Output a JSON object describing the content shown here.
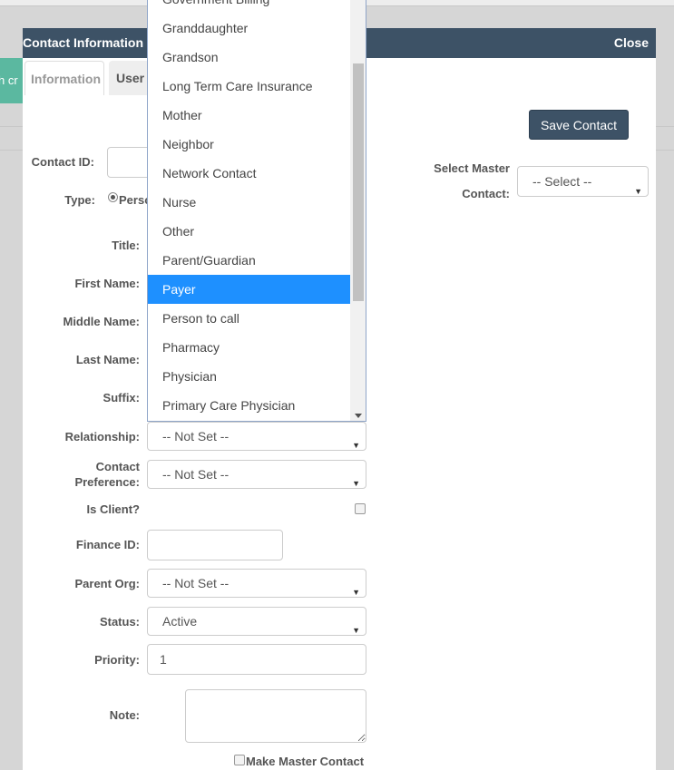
{
  "background": {
    "teal_button_text": "h cr"
  },
  "modal": {
    "title": "Contact Information",
    "close_label": "Close"
  },
  "tabs": [
    {
      "label": "Information"
    },
    {
      "label": "User"
    }
  ],
  "save_button_label": "Save Contact",
  "form": {
    "contact_id_label": "Contact ID:",
    "contact_id_value": "",
    "type_label": "Type:",
    "type_radio_text": "Perso",
    "title_label": "Title:",
    "first_name_label": "First Name:",
    "middle_name_label": "Middle Name:",
    "last_name_label": "Last Name:",
    "suffix_label": "Suffix:",
    "relationship_label": "Relationship:",
    "relationship_value": "-- Not Set --",
    "contact_pref_label_1": "Contact",
    "contact_pref_label_2": "Preference:",
    "contact_pref_value": "-- Not Set --",
    "is_client_label": "Is Client?",
    "finance_id_label": "Finance ID:",
    "finance_id_value": "",
    "parent_org_label": "Parent Org:",
    "parent_org_value": "-- Not Set --",
    "status_label": "Status:",
    "status_value": "Active",
    "priority_label": "Priority:",
    "priority_value": "1",
    "note_label": "Note:",
    "note_value": "",
    "make_master_label": "Make Master Contact",
    "select_master_label_1": "Select Master",
    "select_master_label_2": "Contact:",
    "select_master_value": "-- Select --"
  },
  "dropdown": {
    "items": [
      "Government Billing",
      "Granddaughter",
      "Grandson",
      "Long Term Care Insurance",
      "Mother",
      "Neighbor",
      "Network Contact",
      "Nurse",
      "Other",
      "Parent/Guardian",
      "Payer",
      "Person to call",
      "Pharmacy",
      "Physician",
      "Primary Care Physician"
    ],
    "selected_index": 10
  },
  "colors": {
    "header": "#3d5266",
    "selected_item": "#1e90ff",
    "teal": "#5bb8a0"
  }
}
